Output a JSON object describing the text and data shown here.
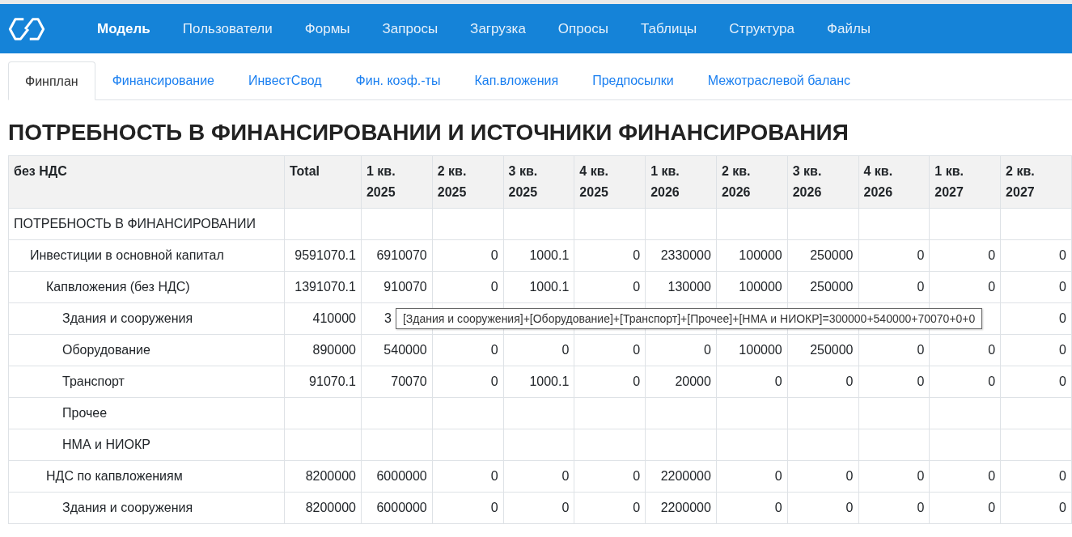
{
  "navbar": {
    "items": [
      {
        "label": "Модель",
        "selected": true
      },
      {
        "label": "Пользователи",
        "selected": false
      },
      {
        "label": "Формы",
        "selected": false
      },
      {
        "label": "Запросы",
        "selected": false
      },
      {
        "label": "Загрузка",
        "selected": false
      },
      {
        "label": "Опросы",
        "selected": false
      },
      {
        "label": "Таблицы",
        "selected": false
      },
      {
        "label": "Структура",
        "selected": false
      },
      {
        "label": "Файлы",
        "selected": false
      }
    ]
  },
  "tabs": [
    {
      "label": "Финплан",
      "selected": true
    },
    {
      "label": "Финансирование",
      "selected": false
    },
    {
      "label": "ИнвестСвод",
      "selected": false
    },
    {
      "label": "Фин. коэф.-ты",
      "selected": false
    },
    {
      "label": "Кап.вложения",
      "selected": false
    },
    {
      "label": "Предпосылки",
      "selected": false
    },
    {
      "label": "Межотраслевой баланс",
      "selected": false
    }
  ],
  "heading": "ПОТРЕБНОСТЬ В ФИНАНСИРОВАНИИ И ИСТОЧНИКИ ФИНАНСИРОВАНИЯ",
  "table": {
    "columns": [
      [
        "без НДС"
      ],
      [
        "Total"
      ],
      [
        "1 кв.",
        "2025"
      ],
      [
        "2 кв.",
        "2025"
      ],
      [
        "3 кв.",
        "2025"
      ],
      [
        "4 кв.",
        "2025"
      ],
      [
        "1 кв.",
        "2026"
      ],
      [
        "2 кв.",
        "2026"
      ],
      [
        "3 кв.",
        "2026"
      ],
      [
        "4 кв.",
        "2026"
      ],
      [
        "1 кв.",
        "2027"
      ],
      [
        "2 кв.",
        "2027"
      ]
    ],
    "rows": [
      {
        "label": "ПОТРЕБНОСТЬ В ФИНАНСИРОВАНИИ",
        "children": [
          {
            "label": "Инвестиции в основной капитал",
            "values": [
              "9591070.1",
              "6910070",
              "0",
              "1000.1",
              "0",
              "2330000",
              "100000",
              "250000",
              "0",
              "0",
              "0"
            ],
            "children": [
              {
                "label": "Капвложения (без НДС)",
                "values": [
                  "1391070.1",
                  "910070",
                  "0",
                  "1000.1",
                  "0",
                  "130000",
                  "100000",
                  "250000",
                  "0",
                  "0",
                  "0"
                ],
                "children": [
                  {
                    "label": "Здания и сооружения",
                    "values": [
                      "410000",
                      "3"
                    ],
                    "last_column": "0",
                    "tooltip": "[Здания и сооружения]+[Оборудование]+[Транспорт]+[Прочее]+[НМА и НИОКР]=300000+540000+70070+0+0"
                  },
                  {
                    "label": "Оборудование",
                    "values": [
                      "890000",
                      "540000",
                      "0",
                      "0",
                      "0",
                      "0",
                      "100000",
                      "250000",
                      "0",
                      "0",
                      "0"
                    ]
                  },
                  {
                    "label": "Транспорт",
                    "values": [
                      "91070.1",
                      "70070",
                      "0",
                      "1000.1",
                      "0",
                      "20000",
                      "0",
                      "0",
                      "0",
                      "0",
                      "0"
                    ]
                  },
                  {
                    "label": "Прочее"
                  },
                  {
                    "label": "НМА и НИОКР"
                  }
                ]
              },
              {
                "label": "НДС по капвложениям",
                "values": [
                  "8200000",
                  "6000000",
                  "0",
                  "0",
                  "0",
                  "2200000",
                  "0",
                  "0",
                  "0",
                  "0",
                  "0"
                ],
                "children": [
                  {
                    "label": "Здания и сооружения",
                    "values": [
                      "8200000",
                      "6000000",
                      "0",
                      "0",
                      "0",
                      "2200000",
                      "0",
                      "0",
                      "0",
                      "0",
                      "0"
                    ]
                  }
                ]
              }
            ]
          }
        ]
      }
    ]
  }
}
